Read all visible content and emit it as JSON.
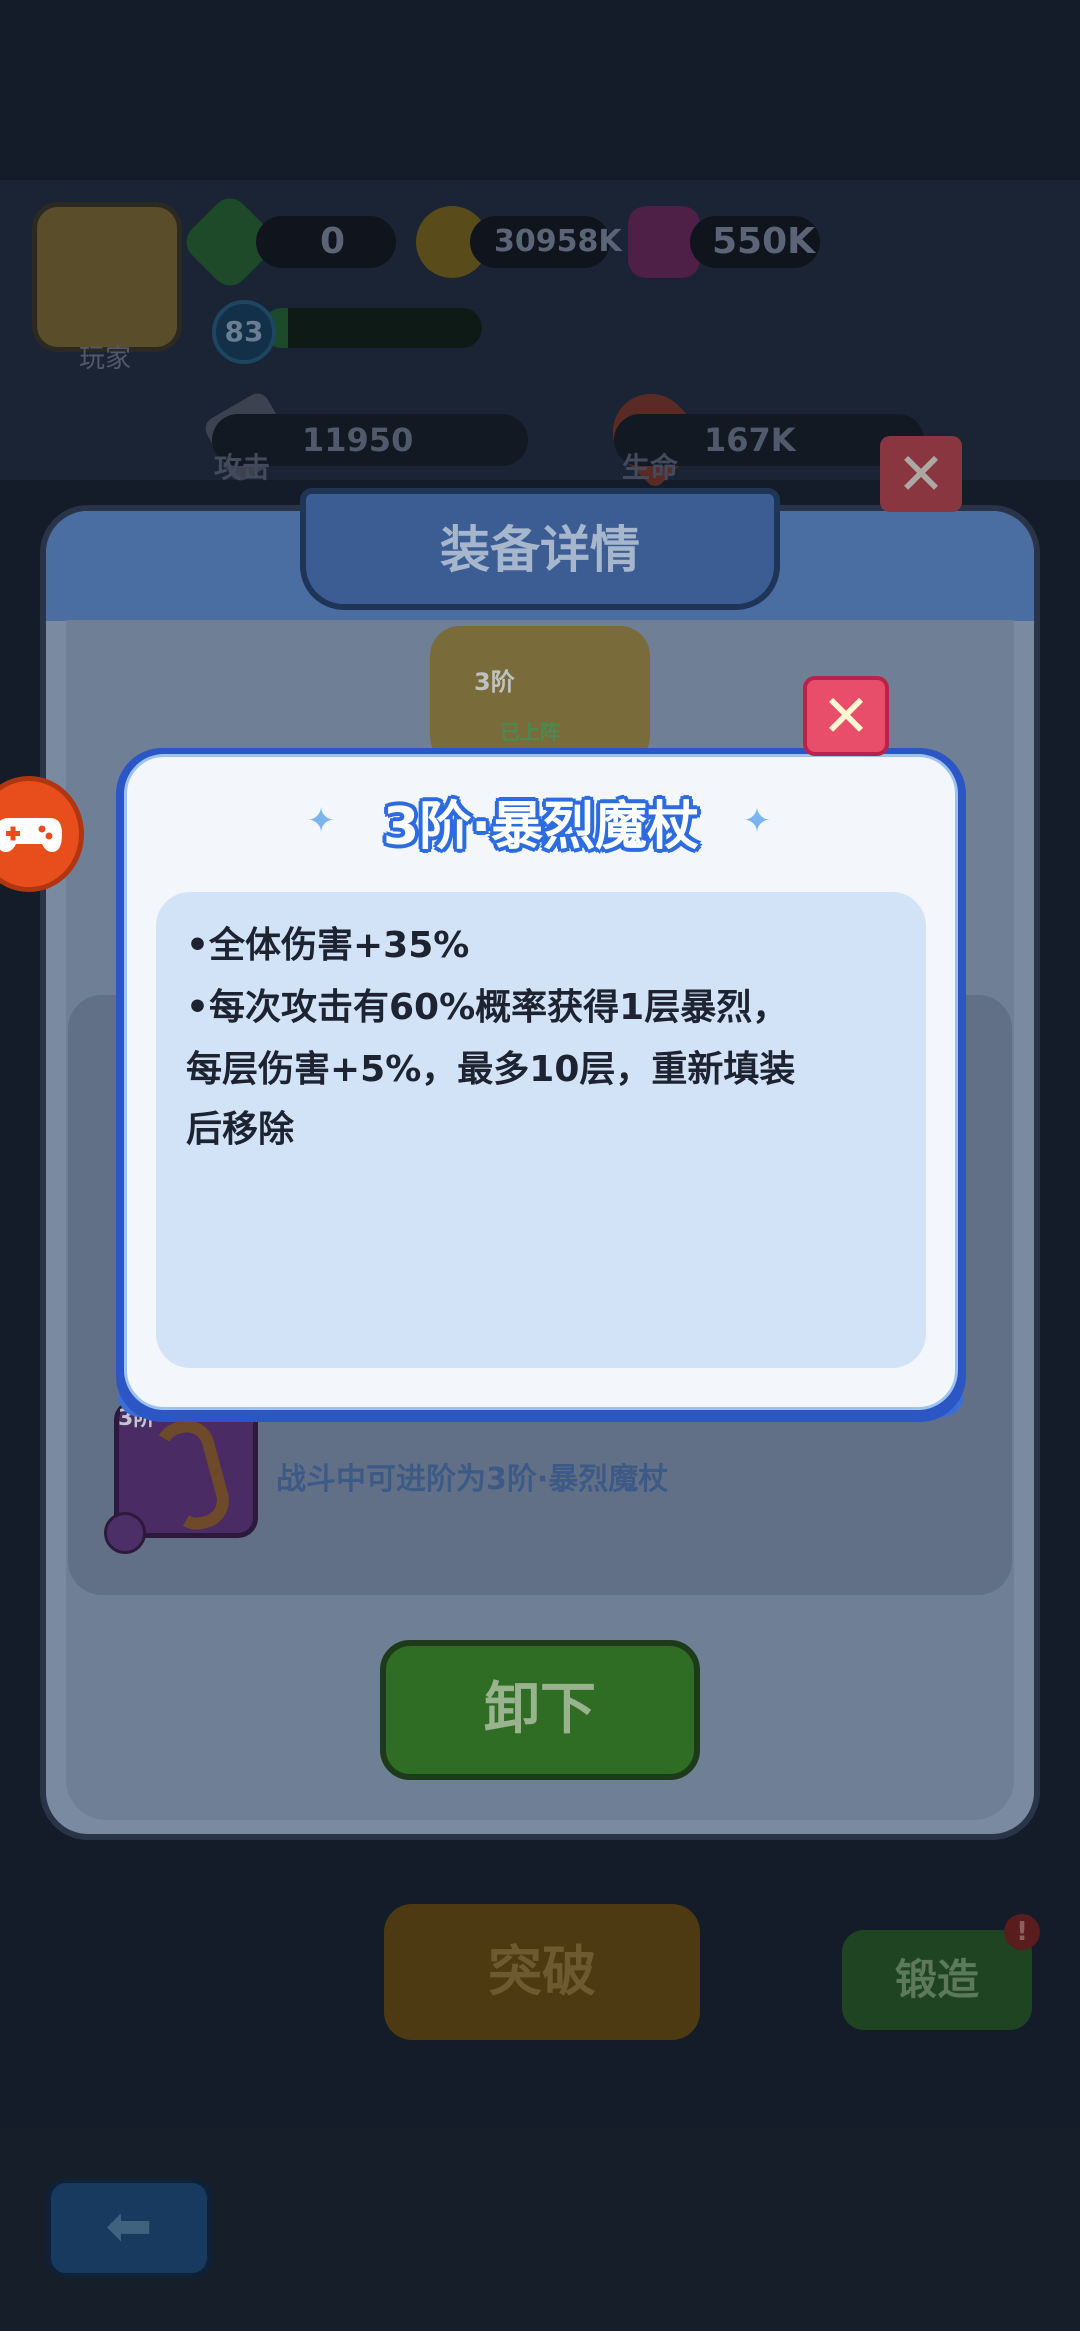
{
  "player": {
    "name": "玩家",
    "level": "83"
  },
  "resources": {
    "energy": "0",
    "gold": "30958K",
    "gems": "550K"
  },
  "stats": {
    "attack_label": "攻击",
    "attack_value": "11950",
    "hp_label": "生命",
    "hp_value": "167K"
  },
  "panel": {
    "title": "装备详情",
    "close_icon": "✕",
    "equipped_tag": "已上阵",
    "item_tier": "3阶",
    "staff_tier": "3阶",
    "advance_text": "战斗中可进阶为3阶·暴烈魔杖",
    "unload_label": "卸下",
    "breakthrough_label": "突破",
    "forge_label": "锻造",
    "forge_badge": "!",
    "back_icon": "⬅"
  },
  "dialog": {
    "title": "3阶·暴烈魔杖",
    "close_icon": "✕",
    "desc": [
      "•全体伤害+35%",
      "•每次攻击有60%概率获得1层暴烈，",
      "每层伤害+5%，最多10层，重新填装",
      "后移除"
    ]
  },
  "colors": {
    "dialog_border": "#2c56c6",
    "dialog_bg": "#f3f7fc",
    "desc_bg": "#d3e3f7",
    "title_outline": "#2c6be0",
    "close_bg": "#e84e6a"
  }
}
